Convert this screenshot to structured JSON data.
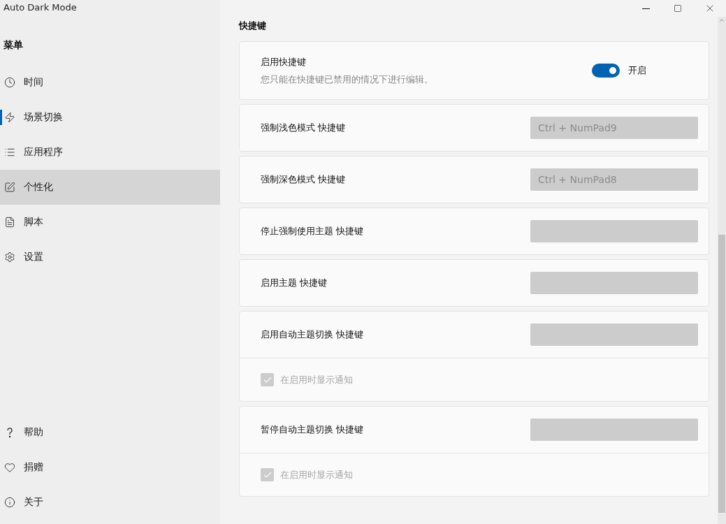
{
  "window": {
    "title": "Auto Dark Mode"
  },
  "sidebar": {
    "heading": "菜单",
    "items": [
      {
        "label": "时间",
        "selected": false,
        "focused": false
      },
      {
        "label": "场景切换",
        "selected": false,
        "focused": true
      },
      {
        "label": "应用程序",
        "selected": false,
        "focused": false
      },
      {
        "label": "个性化",
        "selected": true,
        "focused": false
      },
      {
        "label": "脚本",
        "selected": false,
        "focused": false
      },
      {
        "label": "设置",
        "selected": false,
        "focused": false
      }
    ],
    "footer_items": [
      {
        "label": "帮助",
        "selected": false
      },
      {
        "label": "捐赠",
        "selected": false
      },
      {
        "label": "关于",
        "selected": false
      }
    ]
  },
  "section": {
    "title": "快捷键"
  },
  "cards": [
    {
      "kind": "toggle",
      "label": "启用快捷键",
      "description": "您只能在快捷键已禁用的情况下进行编辑。",
      "on": true,
      "state_label": "开启"
    },
    {
      "kind": "hotkey",
      "label": "强制浅色模式 快捷键",
      "value": "Ctrl + NumPad9",
      "disabled": true
    },
    {
      "kind": "hotkey",
      "label": "强制深色模式 快捷键",
      "value": "Ctrl + NumPad8",
      "disabled": true
    },
    {
      "kind": "hotkey",
      "label": "停止强制使用主题 快捷键",
      "disabled": true
    },
    {
      "kind": "hotkey",
      "label": "启用主题 快捷键",
      "disabled": true
    },
    {
      "kind": "hotkey",
      "label": "启用自动主题切换 快捷键",
      "disabled": true,
      "notify": {
        "label": "在启用时显示通知",
        "checked": true,
        "disabled": true
      }
    },
    {
      "kind": "hotkey",
      "label": "暂停自动主题切换 快捷键",
      "disabled": true,
      "notify": {
        "label": "在启用时显示通知",
        "checked": true,
        "disabled": true
      }
    }
  ]
}
